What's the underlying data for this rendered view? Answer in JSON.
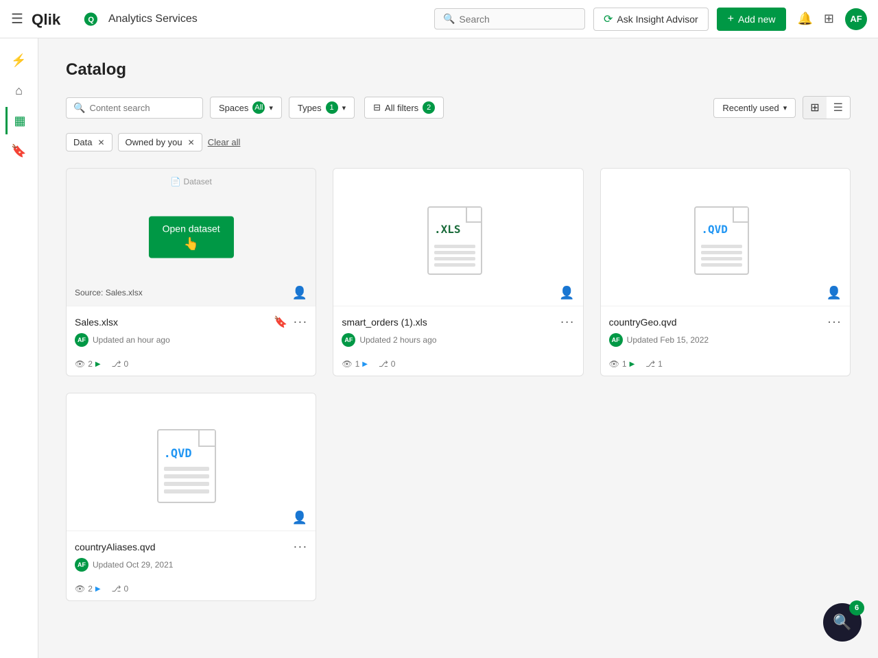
{
  "app": {
    "name": "Analytics Services",
    "logo_alt": "Qlik"
  },
  "topnav": {
    "search_placeholder": "Search",
    "ask_btn_label": "Ask Insight Advisor",
    "add_btn_label": "Add new",
    "avatar_initials": "AF"
  },
  "sidebar": {
    "items": [
      {
        "id": "home",
        "icon": "⌂",
        "label": "Home"
      },
      {
        "id": "catalog",
        "icon": "▦",
        "label": "Catalog",
        "active": true
      },
      {
        "id": "bookmarks",
        "icon": "🔖",
        "label": "Bookmarks"
      }
    ]
  },
  "page": {
    "title": "Catalog"
  },
  "filters": {
    "search_placeholder": "Content search",
    "spaces_label": "Spaces",
    "spaces_value": "All",
    "types_label": "Types",
    "types_badge": "1",
    "allfilters_label": "All filters",
    "allfilters_badge": "2",
    "sort_label": "Recently used",
    "view_grid_label": "Grid view",
    "view_list_label": "List view"
  },
  "active_filters": [
    {
      "id": "data",
      "label": "Data"
    },
    {
      "id": "owned",
      "label": "Owned by you"
    }
  ],
  "clear_all_label": "Clear all",
  "cards": [
    {
      "id": "sales-xlsx",
      "type": "Dataset",
      "file_type": "xls",
      "name": "Sales.xlsx",
      "source": "Sales.xlsx",
      "updated": "Updated an hour ago",
      "avatar": "AF",
      "views": "2",
      "transfers": "0",
      "views_icon": "arrow",
      "hovered": true,
      "open_btn_label": "Open dataset"
    },
    {
      "id": "smart-orders",
      "type": "Dataset",
      "file_type": "xls",
      "name": "smart_orders (1).xls",
      "source": null,
      "updated": "Updated 2 hours ago",
      "avatar": "AF",
      "views": "1",
      "transfers": "0",
      "views_icon": "arrow-blue",
      "hovered": false
    },
    {
      "id": "country-geo",
      "type": "Dataset",
      "file_type": "qvd",
      "name": "countryGeo.qvd",
      "source": null,
      "updated": "Updated Feb 15, 2022",
      "avatar": "AF",
      "views": "1",
      "transfers": "1",
      "views_icon": "arrow",
      "hovered": false
    },
    {
      "id": "country-aliases",
      "type": "Dataset",
      "file_type": "qvd",
      "name": "countryAliases.qvd",
      "source": null,
      "updated": "Updated Oct 29, 2021",
      "avatar": "AF",
      "views": "2",
      "transfers": "0",
      "views_icon": "arrow-blue",
      "hovered": false
    }
  ],
  "floating_badge": {
    "count": "6"
  }
}
